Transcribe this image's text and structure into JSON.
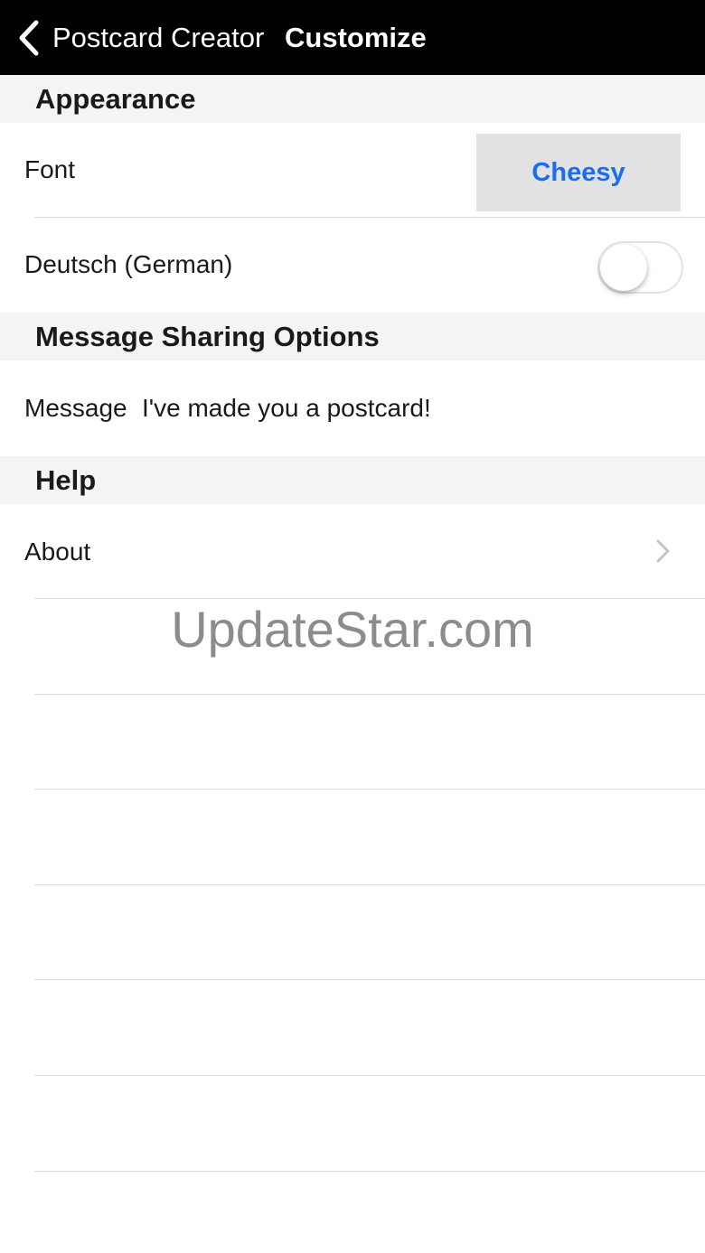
{
  "navbar": {
    "back_label": "Postcard Creator",
    "title": "Customize"
  },
  "sections": {
    "appearance": "Appearance",
    "message_sharing": "Message Sharing Options",
    "help": "Help"
  },
  "appearance": {
    "font_label": "Font",
    "font_value": "Cheesy",
    "german_label": "Deutsch (German)",
    "german_enabled": false
  },
  "message_sharing": {
    "message_label": "Message",
    "message_value": "I've made you a postcard!"
  },
  "help": {
    "about_label": "About"
  },
  "watermark": "UpdateStar.com",
  "colors": {
    "navbar_bg": "#000000",
    "accent": "#1a6cf0",
    "section_bg": "#f4f4f5"
  },
  "icons": {
    "back": "chevron-left-icon",
    "disclosure": "chevron-right-icon"
  }
}
